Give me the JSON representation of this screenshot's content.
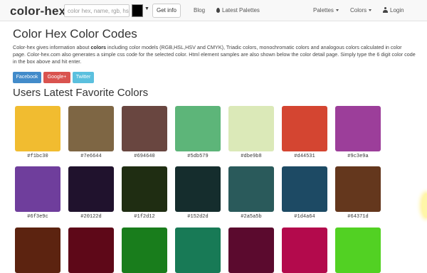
{
  "navbar": {
    "brand": "color-hex",
    "search_placeholder": "color hex, name, rgb, hsl",
    "picker_color": "#000000",
    "get_info_label": "Get info",
    "blog_label": "Blog",
    "latest_palettes_label": "Latest Palettes",
    "palettes_label": "Palettes",
    "colors_label": "Colors",
    "login_label": "Login"
  },
  "page": {
    "title": "Color Hex Color Codes",
    "desc_part1": "Color-hex gives information about ",
    "desc_bold": "colors",
    "desc_part2": " including color models (RGB,HSL,HSV and CMYK), Triadic colors, monochromatic colors and analogous colors calculated in color page. Color-hex.com also generates a simple css code for the selected color. Html element samples are also shown below the color detail page. Simply type the 6 digit color code in the box above and hit enter."
  },
  "share": {
    "facebook": "Facebook",
    "google": "Google+",
    "twitter": "Twitter",
    "colors": {
      "facebook": "#428bca",
      "google": "#d9534f",
      "twitter": "#5bc0de"
    }
  },
  "favorites": {
    "heading": "Users Latest Favorite Colors",
    "rows": [
      [
        {
          "hex": "#f1bc30",
          "label": "#f1bc30"
        },
        {
          "hex": "#7e6644",
          "label": "#7e6644"
        },
        {
          "hex": "#694640",
          "label": "#694640"
        },
        {
          "hex": "#5db579",
          "label": "#5db579"
        },
        {
          "hex": "#dbe9b8",
          "label": "#dbe9b8"
        },
        {
          "hex": "#d44531",
          "label": "#d44531"
        },
        {
          "hex": "#9c3e9a",
          "label": "#9c3e9a"
        }
      ],
      [
        {
          "hex": "#6f3e9c",
          "label": "#6f3e9c"
        },
        {
          "hex": "#20122d",
          "label": "#20122d"
        },
        {
          "hex": "#1f2d12",
          "label": "#1f2d12"
        },
        {
          "hex": "#152d2d",
          "label": "#152d2d"
        },
        {
          "hex": "#2a5a5b",
          "label": "#2a5a5b"
        },
        {
          "hex": "#1d4a64",
          "label": "#1d4a64"
        },
        {
          "hex": "#64371d",
          "label": "#64371d"
        }
      ],
      [
        {
          "hex": "#5c2310"
        },
        {
          "hex": "#5e0818"
        },
        {
          "hex": "#197d1c"
        },
        {
          "hex": "#187a56"
        },
        {
          "hex": "#5b0a2e"
        },
        {
          "hex": "#b30a4c"
        },
        {
          "hex": "#52d123"
        }
      ]
    ]
  }
}
